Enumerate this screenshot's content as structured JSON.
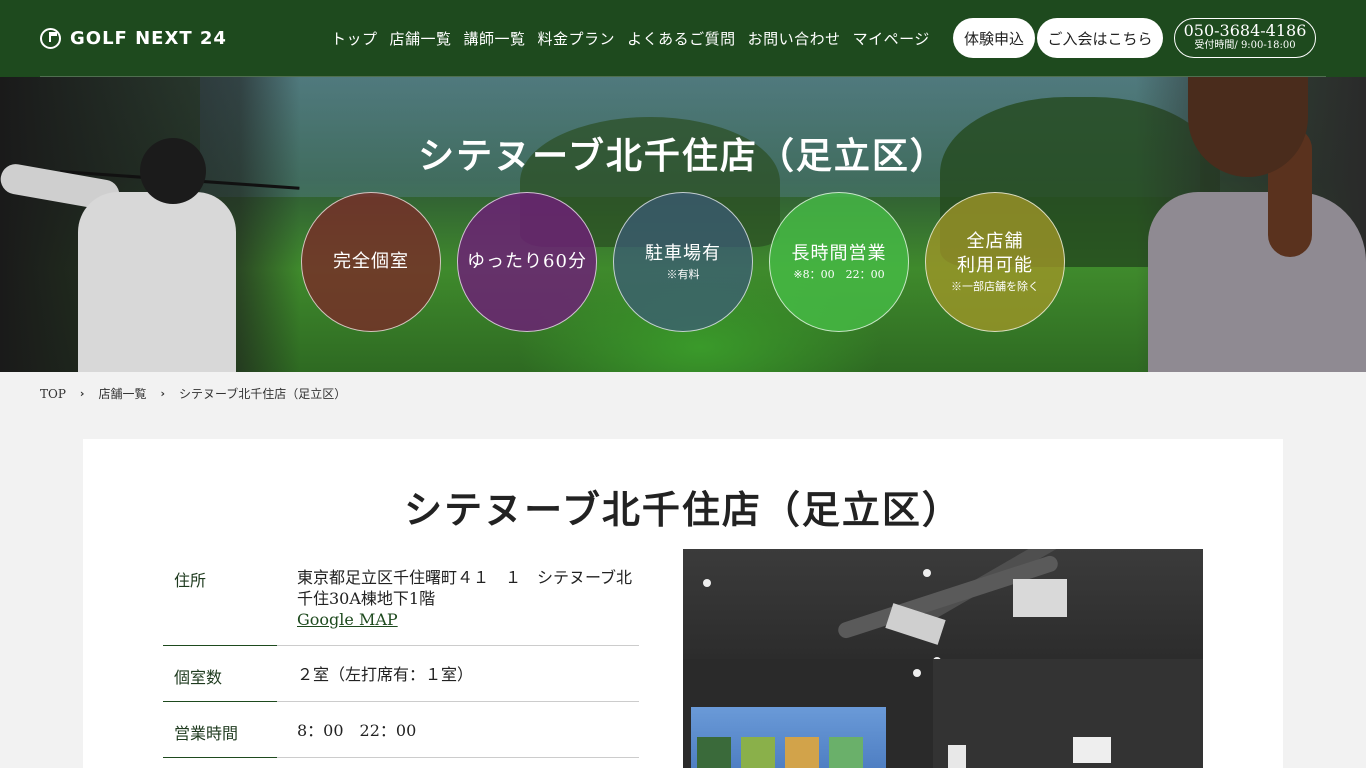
{
  "header": {
    "logo_text": "GOLF NEXT 24",
    "nav": [
      {
        "label": "トップ"
      },
      {
        "label": "店舗一覧"
      },
      {
        "label": "講師一覧"
      },
      {
        "label": "料金プラン"
      },
      {
        "label": "よくあるご質問"
      },
      {
        "label": "お問い合わせ"
      },
      {
        "label": "マイページ"
      }
    ],
    "trial_button": "体験申込",
    "join_button": "ご入会はこちら",
    "phone_number": "050-3684-4186",
    "phone_hours": "受付時間/ 9:00-18:00"
  },
  "hero": {
    "title": "シテヌーブ北千住店（足立区）",
    "features": [
      {
        "main": "完全個室",
        "note": ""
      },
      {
        "main": "ゆったり60分",
        "note": ""
      },
      {
        "main": "駐車場有",
        "note": "※有料"
      },
      {
        "main": "長時間営業",
        "note": "※8：00　22：00"
      },
      {
        "main": "全店舗",
        "main2": "利用可能",
        "note": "※一部店舗を除く"
      }
    ]
  },
  "breadcrumb": {
    "top": "TOP",
    "stores": "店舗一覧",
    "current": "シテヌーブ北千住店（足立区）",
    "separator": "›"
  },
  "store": {
    "title": "シテヌーブ北千住店（足立区）",
    "address_label": "住所",
    "address_value": "東京都足立区千住曙町４１　１　シテヌーブ北千住30A棟地下1階",
    "map_link": "Google MAP",
    "rooms_label": "個室数",
    "rooms_value": "２室（左打席有：１室）",
    "hours_label": "営業時間",
    "hours_value": "8：00　22：00"
  },
  "colors": {
    "header_bg": "#1e4a1e",
    "card_bg": "#ffffff",
    "page_bg": "#f2f2f2"
  }
}
